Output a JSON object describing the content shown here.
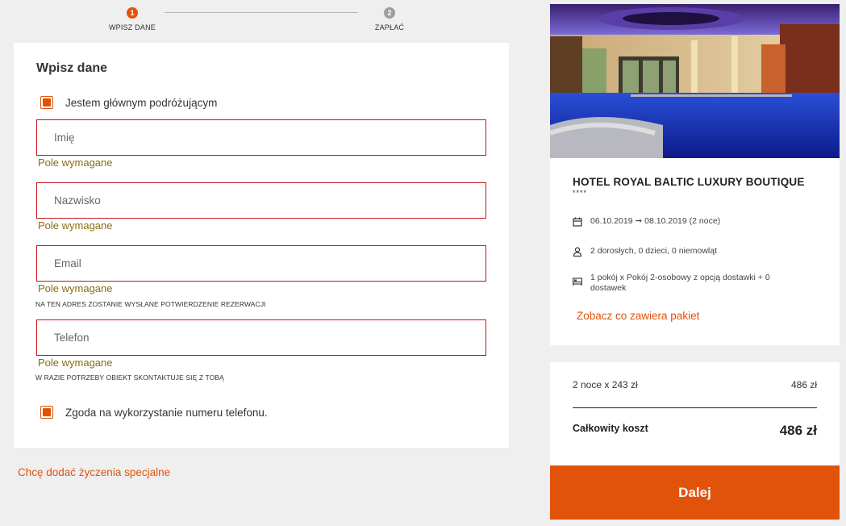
{
  "stepper": {
    "steps": [
      {
        "num": "1",
        "label": "WPISZ DANE"
      },
      {
        "num": "2",
        "label": "ZAPŁAĆ"
      }
    ]
  },
  "form": {
    "title": "Wpisz dane",
    "main_traveler_label": "Jestem głównym podróżującym",
    "fields": {
      "first_name": {
        "placeholder": "Imię",
        "error": "Pole wymagane"
      },
      "last_name": {
        "placeholder": "Nazwisko",
        "error": "Pole wymagane"
      },
      "email": {
        "placeholder": "Email",
        "error": "Pole wymagane",
        "hint": "NA TEN ADRES ZOSTANIE WYSŁANE POTWIERDZENIE REZERWACJI"
      },
      "phone": {
        "placeholder": "Telefon",
        "error": "Pole wymagane",
        "hint": "W RAZIE POTRZEBY OBIEKT SKONTAKTUJE SIĘ Z TOBĄ"
      }
    },
    "phone_consent_label": "Zgoda na wykorzystanie numeru telefonu."
  },
  "special_requests_link": "Chcę dodać życzenia specjalne",
  "hotel": {
    "name": "HOTEL ROYAL BALTIC LUXURY BOUTIQUE",
    "stars": "****",
    "dates": "06.10.2019 ➞ 08.10.2019 (2 noce)",
    "guests": "2 dorosłych, 0 dzieci, 0 niemowląt",
    "room": "1 pokój x Pokój 2-osobowy z opcją dostawki + 0 dostawek",
    "package_link": "Zobacz co zawiera pakiet",
    "icons": [
      "calendar-icon",
      "person-icon",
      "bed-icon"
    ]
  },
  "price": {
    "line_label": "2 noce x 243 zł",
    "line_value": "486 zł",
    "total_label": "Całkowity koszt",
    "total_value": "486 zł"
  },
  "next_button": "Dalej",
  "colors": {
    "accent": "#e1520a",
    "error_border": "#c9141c",
    "error_text": "#8a6d12"
  }
}
